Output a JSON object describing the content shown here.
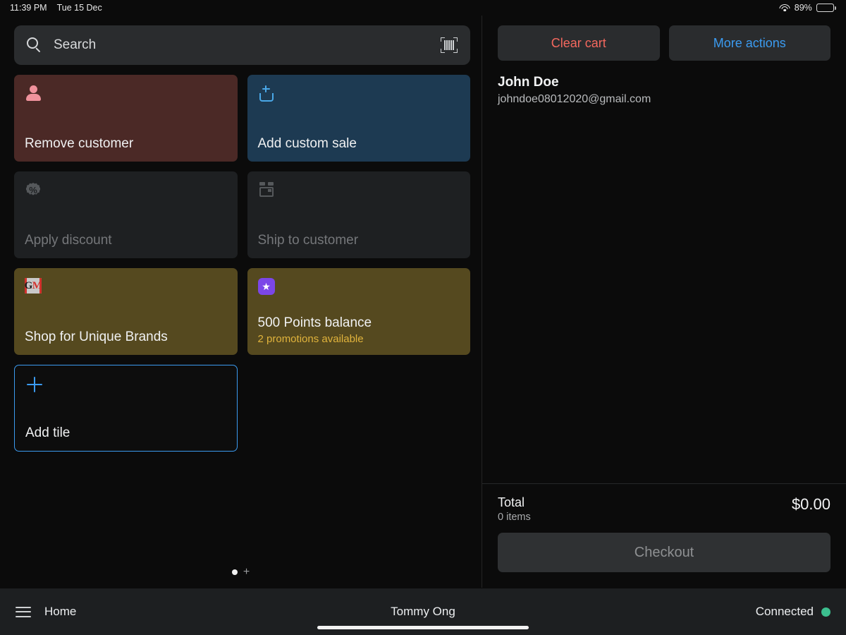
{
  "statusbar": {
    "time": "11:39 PM",
    "date": "Tue 15 Dec",
    "battery_percent": "89%",
    "wifi_icon": "wifi-icon",
    "battery_icon": "battery-icon"
  },
  "search": {
    "placeholder": "Search",
    "value": "",
    "search_icon": "search-icon",
    "scan_icon": "barcode-scan-icon"
  },
  "tiles": [
    {
      "label": "Remove customer",
      "sub": "",
      "icon": "person-icon",
      "style": "remove",
      "disabled": false
    },
    {
      "label": "Add custom sale",
      "sub": "",
      "icon": "add-to-tray-icon",
      "style": "customsale",
      "disabled": false
    },
    {
      "label": "Apply discount",
      "sub": "",
      "icon": "discount-badge-icon",
      "style": "disabled",
      "disabled": true
    },
    {
      "label": "Ship to customer",
      "sub": "",
      "icon": "shipping-box-icon",
      "style": "disabled",
      "disabled": true
    },
    {
      "label": "Shop for Unique Brands",
      "sub": "",
      "icon": "gm-logo-icon",
      "style": "brands",
      "disabled": false
    },
    {
      "label": "500 Points balance",
      "sub": "2 promotions available",
      "icon": "star-badge-icon",
      "style": "points",
      "disabled": false
    },
    {
      "label": "Add tile",
      "sub": "",
      "icon": "plus-icon",
      "style": "addtile",
      "disabled": false
    }
  ],
  "gm_logo": {
    "left": "G",
    "right": "M"
  },
  "star_glyph": "★",
  "pager": {
    "add_glyph": "+",
    "pages": 1,
    "current": 1
  },
  "cart": {
    "clear_label": "Clear cart",
    "more_label": "More actions",
    "customer_name": "John Doe",
    "customer_email": "johndoe08012020@gmail.com",
    "total_label": "Total",
    "items_label": "0 items",
    "total_amount": "$0.00",
    "checkout_label": "Checkout"
  },
  "bottombar": {
    "menu_icon": "hamburger-menu-icon",
    "home_label": "Home",
    "user_name": "Tommy Ong",
    "connection_label": "Connected",
    "connection_dot": "connected-status-dot"
  },
  "colors": {
    "accent_blue": "#3b9bf0",
    "danger_red": "#f4685e",
    "promo_gold": "#e0b33c",
    "connected_green": "#3cbf8f",
    "points_bg": "#55491f",
    "remove_bg": "#4b2926",
    "customsale_bg": "#1d3a52",
    "star_purple": "#7b46e8"
  }
}
